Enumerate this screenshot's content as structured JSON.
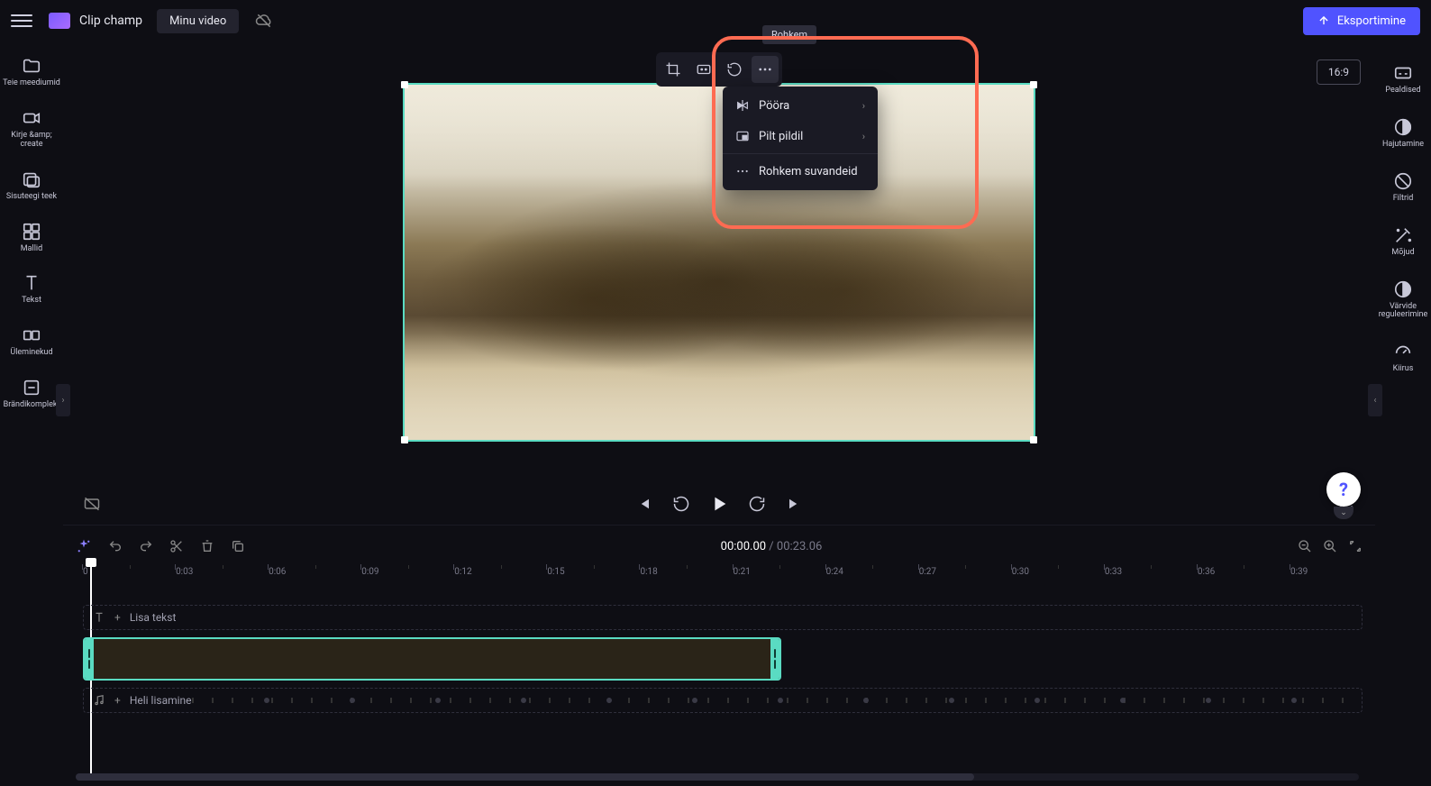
{
  "topbar": {
    "brand": "Clip champ",
    "video_title": "Minu video",
    "export_label": "Eksportimine"
  },
  "left_rail": {
    "items": [
      {
        "label": "Teie meediumid"
      },
      {
        "label": "Kirje &amp;\ncreate"
      },
      {
        "label": "Sisuteegi teek"
      },
      {
        "label": "Mallid"
      },
      {
        "label": "Tekst"
      },
      {
        "label": "Üleminekud"
      },
      {
        "label": "Brändikomplekt"
      }
    ]
  },
  "right_rail": {
    "items": [
      {
        "label": "Pealdised"
      },
      {
        "label": "Hajutamine"
      },
      {
        "label": "Filtrid"
      },
      {
        "label": "Mõjud"
      },
      {
        "label": "Värvide reguleerimine"
      },
      {
        "label": "Kiirus"
      }
    ]
  },
  "preview": {
    "aspect_label": "16:9",
    "tooltip": "Rohkem",
    "menu": {
      "rotate": "Pööra",
      "pip": "Pilt pildil",
      "more": "Rohkem suvandeid"
    }
  },
  "timeline": {
    "current": "00:00.00",
    "sep": " / ",
    "duration": "00:23.06",
    "ticks": [
      "0",
      "0:03",
      "0:06",
      "0:09",
      "0:12",
      "0:15",
      "0:18",
      "0:21",
      "0:24",
      "0:27",
      "0:30",
      "0:33",
      "0:36",
      "0:39"
    ],
    "text_track_label": "Lisa tekst",
    "audio_track_label": "Heli lisamine"
  },
  "help": "?"
}
